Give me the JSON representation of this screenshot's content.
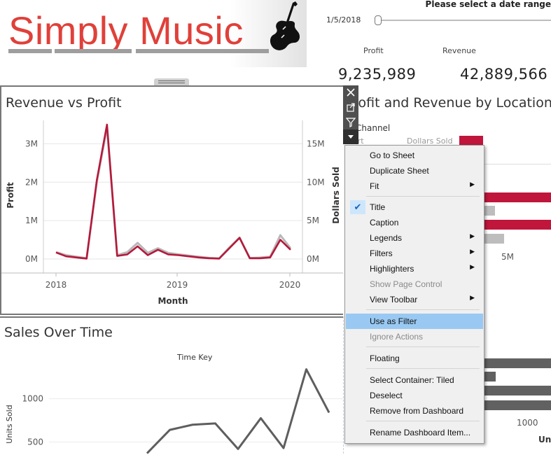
{
  "header": {
    "logo_text": "Simply Music",
    "logo_color": "#e0403a",
    "logo_icon": "violin-icon"
  },
  "date_filter": {
    "title": "Please select a date range",
    "start_value": "1/5/2018"
  },
  "kpis": {
    "profit_label": "Profit",
    "profit_value": "9,235,989",
    "revenue_label": "Revenue",
    "revenue_value": "42,889,566"
  },
  "revenue_panel": {
    "title": "Revenue vs Profit"
  },
  "location_panel": {
    "title": "Profit and Revenue by Location",
    "column_header": "Channel",
    "row_label_partial": "ort",
    "measure_label": "Dollars Sold",
    "axis_tick": "5M"
  },
  "sales_panel": {
    "title": "Sales Over Time",
    "subtitle": "Time Key"
  },
  "bottom_right_panel": {
    "axis_tick": "1000",
    "axis_label_partial": "Uni"
  },
  "toolbar": {
    "close_icon": "close-icon",
    "popout_icon": "popout-icon",
    "filter_icon": "filter-icon",
    "more_icon": "dropdown-arrow-icon"
  },
  "context_menu": {
    "items": [
      {
        "label": "Go to Sheet",
        "submenu": false
      },
      {
        "label": "Duplicate Sheet",
        "submenu": false
      },
      {
        "label": "Fit",
        "submenu": true
      },
      {
        "label": "Title",
        "checked": true
      },
      {
        "label": "Caption"
      },
      {
        "label": "Legends",
        "submenu": true
      },
      {
        "label": "Filters",
        "submenu": true
      },
      {
        "label": "Highlighters",
        "submenu": true
      },
      {
        "label": "Show Page Control",
        "disabled": true
      },
      {
        "label": "View Toolbar",
        "submenu": true
      },
      {
        "label": "Use as Filter",
        "highlighted": true
      },
      {
        "label": "Ignore Actions",
        "disabled": true
      },
      {
        "label": "Floating"
      },
      {
        "label": "Select Container: Tiled"
      },
      {
        "label": "Deselect"
      },
      {
        "label": "Remove from Dashboard"
      },
      {
        "label": "Rename Dashboard Item..."
      }
    ]
  },
  "colors": {
    "profit_line": "#b5183b",
    "revenue_line": "#b8b8b8",
    "bar_dark": "#616161",
    "bar_red": "#c0163c",
    "bar_gray": "#bdbdbd",
    "menu_highlight": "#99c9f2"
  },
  "chart_data": [
    {
      "type": "line",
      "title": "Revenue vs Profit",
      "xlabel": "Month",
      "ylabel": "Profit",
      "ylabel_right": "Dollars Sold",
      "x_ticks": [
        "2018",
        "2019",
        "2020"
      ],
      "y_ticks_left": [
        "0M",
        "1M",
        "2M",
        "3M"
      ],
      "y_ticks_right": [
        "0M",
        "5M",
        "10M",
        "15M"
      ],
      "ylim": [
        0,
        3.5
      ],
      "ylim_right": [
        0,
        17.5
      ],
      "x": [
        0,
        1,
        2,
        3,
        4,
        5,
        6,
        7,
        8,
        9,
        10,
        11,
        12,
        13,
        14,
        15,
        16,
        17,
        18,
        19,
        20,
        21,
        22,
        23,
        24,
        25
      ],
      "series": [
        {
          "name": "Profit",
          "values": [
            0.17,
            0.07,
            0.04,
            0.01,
            2.05,
            3.5,
            0.08,
            0.12,
            0.33,
            0.1,
            0.24,
            0.12,
            0.1,
            0.07,
            0.04,
            0.02,
            0.01,
            0.28,
            0.55,
            0.02,
            0.02,
            0.04,
            0.5,
            0.24
          ]
        },
        {
          "name": "Dollars Sold",
          "values": [
            0.9,
            0.5,
            0.3,
            0.1,
            10.0,
            17.1,
            0.5,
            0.9,
            2.1,
            0.8,
            1.4,
            0.8,
            0.6,
            0.45,
            0.3,
            0.15,
            0.08,
            1.5,
            2.8,
            0.12,
            0.18,
            0.3,
            3.1,
            1.4
          ]
        }
      ]
    },
    {
      "type": "line",
      "title": "Sales Over Time",
      "subtitle": "Time Key",
      "ylabel": "Units Sold",
      "y_ticks": [
        "500",
        "1000"
      ],
      "ylim": [
        350,
        1450
      ],
      "series": [
        {
          "name": "Units Sold",
          "values": [
            null,
            null,
            null,
            null,
            null,
            370,
            640,
            700,
            715,
            420,
            775,
            430,
            1340,
            840
          ]
        }
      ]
    }
  ]
}
